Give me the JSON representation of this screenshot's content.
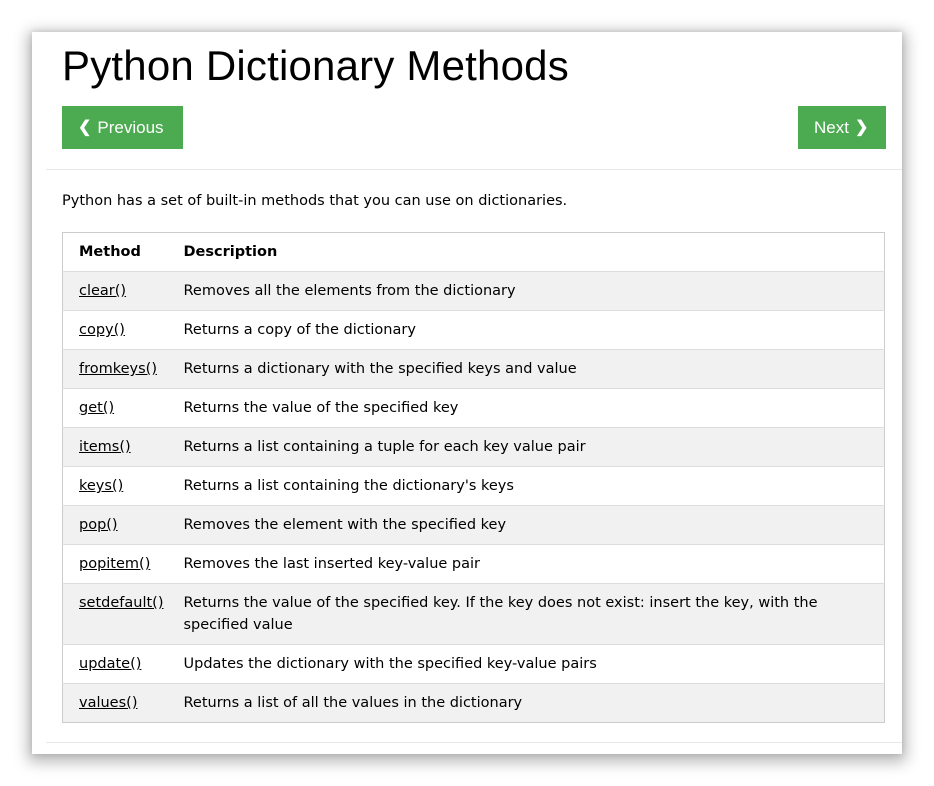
{
  "page": {
    "title": "Python Dictionary Methods",
    "intro": "Python has a set of built-in methods that you can use on dictionaries.",
    "accent_color": "#4caa50"
  },
  "nav": {
    "previous_label": "Previous",
    "previous_icon": "chevron-left-icon",
    "next_label": "Next",
    "next_icon": "chevron-right-icon"
  },
  "table": {
    "headers": [
      "Method",
      "Description"
    ],
    "rows": [
      {
        "method": "clear()",
        "description": "Removes all the elements from the dictionary"
      },
      {
        "method": "copy()",
        "description": "Returns a copy of the dictionary"
      },
      {
        "method": "fromkeys()",
        "description": "Returns a dictionary with the specified keys and value"
      },
      {
        "method": "get()",
        "description": "Returns the value of the specified key"
      },
      {
        "method": "items()",
        "description": "Returns a list containing a tuple for each key value pair"
      },
      {
        "method": "keys()",
        "description": "Returns a list containing the dictionary's keys"
      },
      {
        "method": "pop()",
        "description": "Removes the element with the specified key"
      },
      {
        "method": "popitem()",
        "description": "Removes the last inserted key-value pair"
      },
      {
        "method": "setdefault()",
        "description": "Returns the value of the specified key. If the key does not exist: insert the key, with the specified value"
      },
      {
        "method": "update()",
        "description": "Updates the dictionary with the specified key-value pairs"
      },
      {
        "method": "values()",
        "description": "Returns a list of all the values in the dictionary"
      }
    ]
  }
}
